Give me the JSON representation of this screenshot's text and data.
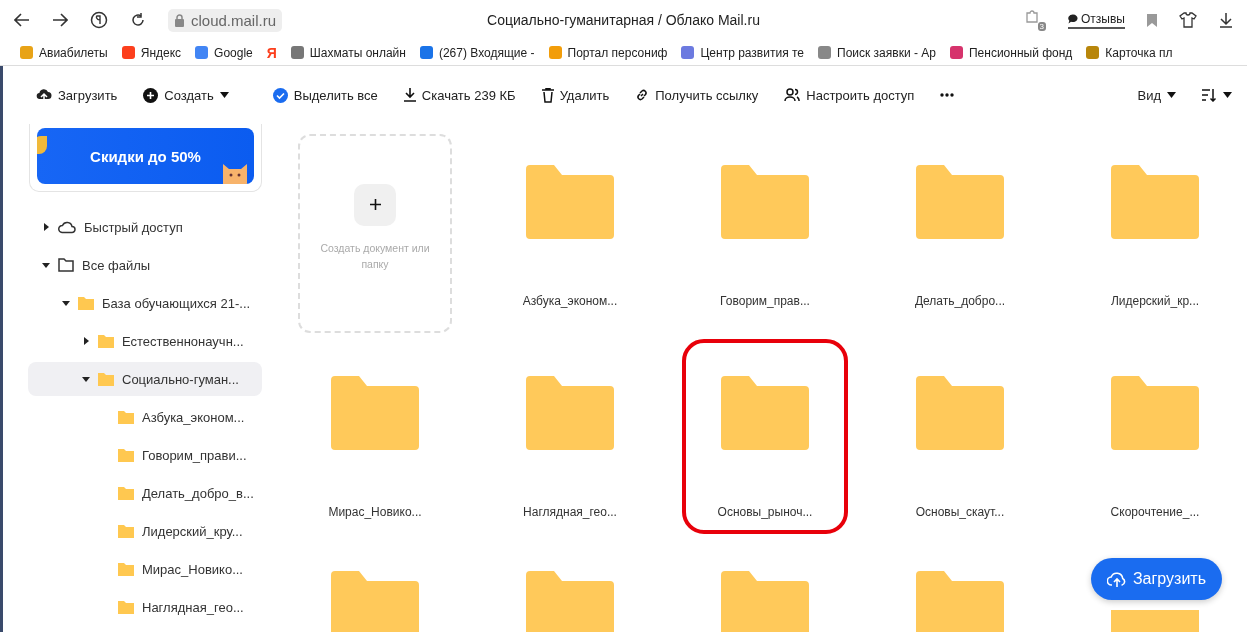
{
  "browser": {
    "address": "cloud.mail.ru",
    "title": "Социально-гуманитарная / Облако Mail.ru",
    "extension_badge": "3",
    "feedback": "Отзывы"
  },
  "bookmarks": [
    {
      "label": "Авиабилеты"
    },
    {
      "label": "Яндекс"
    },
    {
      "label": "Google"
    },
    {
      "label": "Я"
    },
    {
      "label": "Шахматы онлайн"
    },
    {
      "label": "(267) Входящие - "
    },
    {
      "label": "Портал персониф"
    },
    {
      "label": "Центр развития те"
    },
    {
      "label": "Поиск заявки - Ар"
    },
    {
      "label": "Пенсионный фонд"
    },
    {
      "label": "Карточка пл"
    }
  ],
  "toolbar": {
    "upload": "Загрузить",
    "create": "Создать",
    "select_all": "Выделить все",
    "download": "Скачать 239 КБ",
    "delete": "Удалить",
    "get_link": "Получить ссылку",
    "access": "Настроить доступ",
    "view": "Вид"
  },
  "promo": {
    "text": "Скидки до 50%"
  },
  "tree": [
    {
      "label": "Быстрый доступ",
      "kind": "quick",
      "expanded": false,
      "selected": false
    },
    {
      "label": "Все файлы",
      "kind": "root",
      "expanded": true,
      "selected": false,
      "children": [
        {
          "label": "База обучающихся 21-...",
          "kind": "folder",
          "expanded": true,
          "selected": false,
          "children": [
            {
              "label": "Естественнонаучн...",
              "kind": "folder",
              "expanded": false,
              "selected": false
            },
            {
              "label": "Социально-гуман...",
              "kind": "folder",
              "expanded": true,
              "selected": true,
              "children": [
                {
                  "label": "Азбука_эконом...",
                  "kind": "folder",
                  "selected": false
                },
                {
                  "label": "Говорим_прави...",
                  "kind": "folder",
                  "selected": false
                },
                {
                  "label": "Делать_добро_в...",
                  "kind": "folder",
                  "selected": false
                },
                {
                  "label": "Лидерский_кру...",
                  "kind": "folder",
                  "selected": false
                },
                {
                  "label": "Мирас_Новико...",
                  "kind": "folder",
                  "selected": false
                },
                {
                  "label": "Наглядная_гео...",
                  "kind": "folder",
                  "selected": false
                }
              ]
            }
          ]
        }
      ]
    }
  ],
  "grid": [
    {
      "kind": "create",
      "label": "Создать документ или папку"
    },
    {
      "kind": "folder",
      "label": "Азбука_эконом...",
      "highlighted": false
    },
    {
      "kind": "folder",
      "label": "Говорим_прав...",
      "highlighted": false
    },
    {
      "kind": "folder",
      "label": "Делать_добро...",
      "highlighted": false
    },
    {
      "kind": "folder",
      "label": "Лидерский_кр...",
      "highlighted": false
    },
    {
      "kind": "folder",
      "label": "Мирас_Новико...",
      "highlighted": false
    },
    {
      "kind": "folder",
      "label": "Наглядная_гео...",
      "highlighted": false
    },
    {
      "kind": "folder",
      "label": "Основы_рыноч...",
      "highlighted": true
    },
    {
      "kind": "folder",
      "label": "Основы_скаут...",
      "highlighted": false
    },
    {
      "kind": "folder",
      "label": "Скорочтение_...",
      "highlighted": false
    },
    {
      "kind": "folder",
      "highlighted": false
    },
    {
      "kind": "folder",
      "highlighted": false
    },
    {
      "kind": "folder",
      "highlighted": false
    },
    {
      "kind": "folder",
      "highlighted": false
    },
    {
      "kind": "folder_partial"
    }
  ],
  "upload_button": "Загрузить"
}
